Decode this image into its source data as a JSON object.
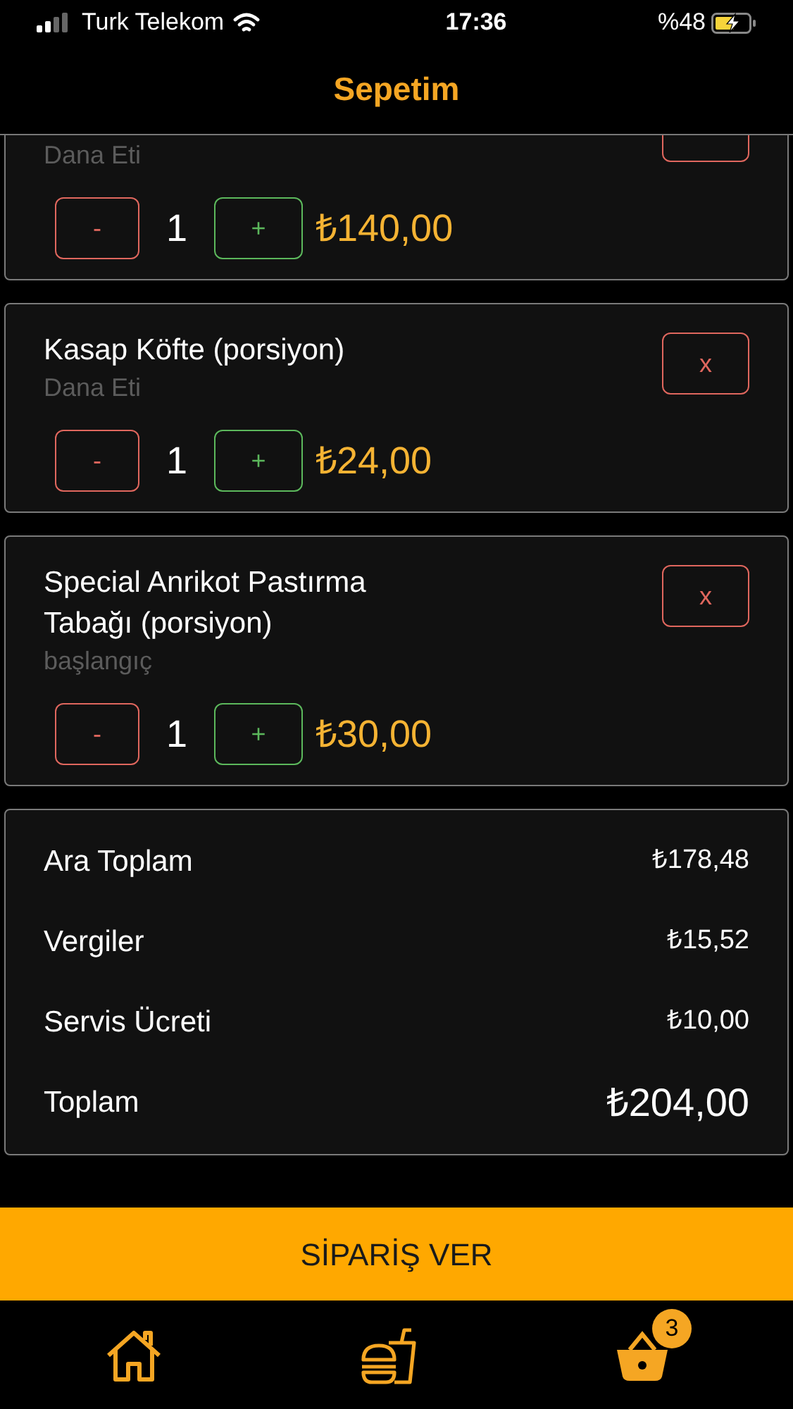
{
  "status_bar": {
    "carrier": "Turk Telekom",
    "time": "17:36",
    "battery": "%48",
    "charging": true
  },
  "header": {
    "title": "Sepetim"
  },
  "cart_items": [
    {
      "subtitle": "Dana Eti",
      "quantity": "1",
      "decrease": "-",
      "increase": "+",
      "price": "₺140,00"
    },
    {
      "title": "Kasap Köfte (porsiyon)",
      "subtitle": "Dana Eti",
      "remove": "x",
      "quantity": "1",
      "decrease": "-",
      "increase": "+",
      "price": "₺24,00"
    },
    {
      "title": "Special Anrikot Pastırma Tabağı (porsiyon)",
      "subtitle": "başlangıç",
      "remove": "x",
      "quantity": "1",
      "decrease": "-",
      "increase": "+",
      "price": "₺30,00"
    }
  ],
  "summary": [
    {
      "label": "Ara Toplam",
      "value": "₺178,48",
      "kind": "line"
    },
    {
      "label": "Vergiler",
      "value": "₺15,52",
      "kind": "line"
    },
    {
      "label": "Servis Ücreti",
      "value": "₺10,00",
      "kind": "line"
    },
    {
      "label": "Toplam",
      "value": "₺204,00",
      "kind": "total"
    }
  ],
  "order_button": "SİPARİŞ VER",
  "tab_bar": [
    {
      "kind": "home",
      "selected": false
    },
    {
      "kind": "menu",
      "selected": false
    },
    {
      "kind": "cart",
      "badge": "3",
      "selected": false
    }
  ]
}
